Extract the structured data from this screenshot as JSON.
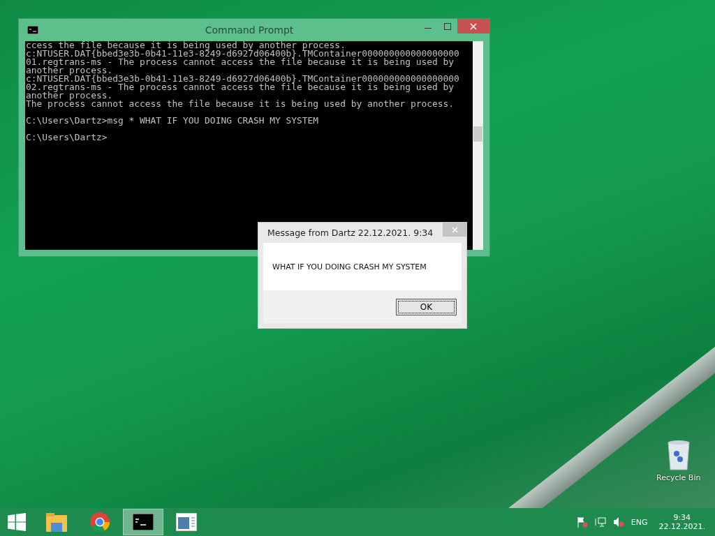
{
  "console_window": {
    "title": "Command Prompt",
    "blocks": [
      [
        "ccess the file because it is being used by another process.",
        "c:NTUSER.DAT{bbed3e3b-0b41-11e3-8249-d6927d06400b}.TMContainer000000000000000000",
        "01.regtrans-ms - The process cannot access the file because it is being used by",
        "another process.",
        "c:NTUSER.DAT{bbed3e3b-0b41-11e3-8249-d6927d06400b}.TMContainer000000000000000000",
        "02.regtrans-ms - The process cannot access the file because it is being used by",
        "another process.",
        "The process cannot access the file because it is being used by another process."
      ],
      [
        "C:\\Users\\Dartz>msg * WHAT IF YOU DOING CRASH MY SYSTEM"
      ],
      [
        "C:\\Users\\Dartz>"
      ]
    ]
  },
  "message_dialog": {
    "title": "Message from Dartz 22.12.2021. 9:34",
    "message": "WHAT IF YOU DOING CRASH MY SYSTEM",
    "buttons": [
      "OK"
    ]
  },
  "desktop_icons": [
    {
      "label": "Recycle Bin"
    }
  ],
  "taskbar": {
    "apps": [
      {
        "kind": "explorer",
        "selected": false
      },
      {
        "kind": "chrome",
        "selected": false
      },
      {
        "kind": "console",
        "selected": true
      },
      {
        "kind": "window",
        "selected": false
      }
    ],
    "language": "ENG",
    "time": "9:34",
    "date": "22.12.2021."
  }
}
